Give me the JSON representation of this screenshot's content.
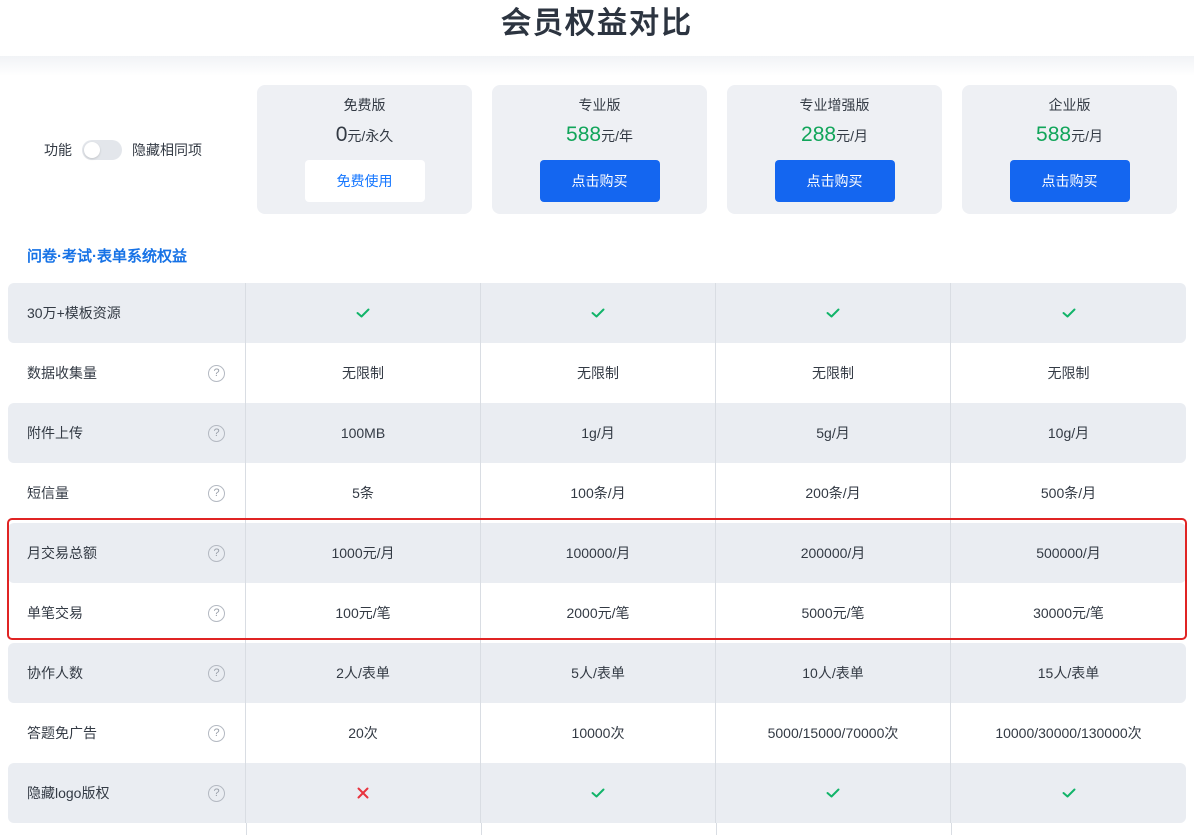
{
  "page_title": "会员权益对比",
  "header": {
    "feature_label": "功能",
    "hide_same_label": "隐藏相同项",
    "toggle_on": false
  },
  "plans": [
    {
      "name": "免费版",
      "price": "0",
      "unit": "元/永久",
      "button": "免费使用"
    },
    {
      "name": "专业版",
      "price": "588",
      "unit": "元/年",
      "button": "点击购买"
    },
    {
      "name": "专业增强版",
      "price": "288",
      "unit": "元/月",
      "button": "点击购买"
    },
    {
      "name": "企业版",
      "price": "588",
      "unit": "元/月",
      "button": "点击购买"
    }
  ],
  "section_title": "问卷·考试·表单系统权益",
  "help_glyph": "?",
  "rows": [
    {
      "feature": "30万+模板资源",
      "help": false,
      "values": [
        "check",
        "check",
        "check",
        "check"
      ]
    },
    {
      "feature": "数据收集量",
      "help": true,
      "values": [
        "无限制",
        "无限制",
        "无限制",
        "无限制"
      ]
    },
    {
      "feature": "附件上传",
      "help": true,
      "values": [
        "100MB",
        "1g/月",
        "5g/月",
        "10g/月"
      ]
    },
    {
      "feature": "短信量",
      "help": true,
      "values": [
        "5条",
        "100条/月",
        "200条/月",
        "500条/月"
      ]
    },
    {
      "feature": "月交易总额",
      "help": true,
      "values": [
        "1000元/月",
        "100000/月",
        "200000/月",
        "500000/月"
      ]
    },
    {
      "feature": "单笔交易",
      "help": true,
      "values": [
        "100元/笔",
        "2000元/笔",
        "5000元/笔",
        "30000元/笔"
      ]
    },
    {
      "feature": "协作人数",
      "help": true,
      "values": [
        "2人/表单",
        "5人/表单",
        "10人/表单",
        "15人/表单"
      ]
    },
    {
      "feature": "答题免广告",
      "help": true,
      "values": [
        "20次",
        "10000次",
        "5000/15000/70000次",
        "10000/30000/130000次"
      ]
    },
    {
      "feature": "隐藏logo版权",
      "help": true,
      "values": [
        "cross",
        "check",
        "check",
        "check"
      ]
    }
  ],
  "colors": {
    "accent_blue": "#1466f0",
    "price_green": "#11a55a",
    "check_green": "#11b469",
    "cross_red": "#e8343f",
    "highlight_red": "#e02424"
  }
}
